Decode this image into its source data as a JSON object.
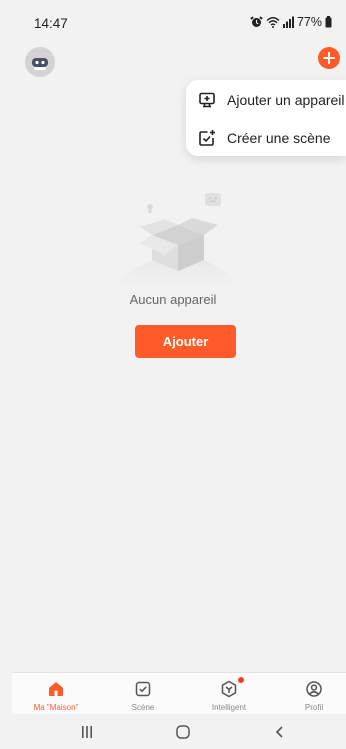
{
  "status_bar": {
    "time": "14:47",
    "battery": "77%",
    "icons": [
      "alarm-icon",
      "wifi-icon",
      "signal-icon",
      "battery-icon"
    ]
  },
  "header": {
    "avatar_icon": "robot-avatar-icon",
    "add_icon": "plus-circle-icon"
  },
  "menu": {
    "items": [
      {
        "label": "Ajouter un appareil",
        "icon": "device-add-icon"
      },
      {
        "label": "Créer une scène",
        "icon": "scene-add-icon"
      }
    ]
  },
  "empty_state": {
    "text": "Aucun appareil",
    "button_label": "Ajouter"
  },
  "tabs": [
    {
      "label": "Ma \"Maison\"",
      "icon": "home-icon",
      "active": true
    },
    {
      "label": "Scène",
      "icon": "scene-icon",
      "active": false
    },
    {
      "label": "Intelligent",
      "icon": "smart-icon",
      "active": false
    },
    {
      "label": "Profil",
      "icon": "profile-icon",
      "active": false
    }
  ],
  "colors": {
    "accent": "#ff5a28",
    "background": "#f2f2f2",
    "inactive_tab": "#888888",
    "notification_dot": "#ff3b30"
  }
}
